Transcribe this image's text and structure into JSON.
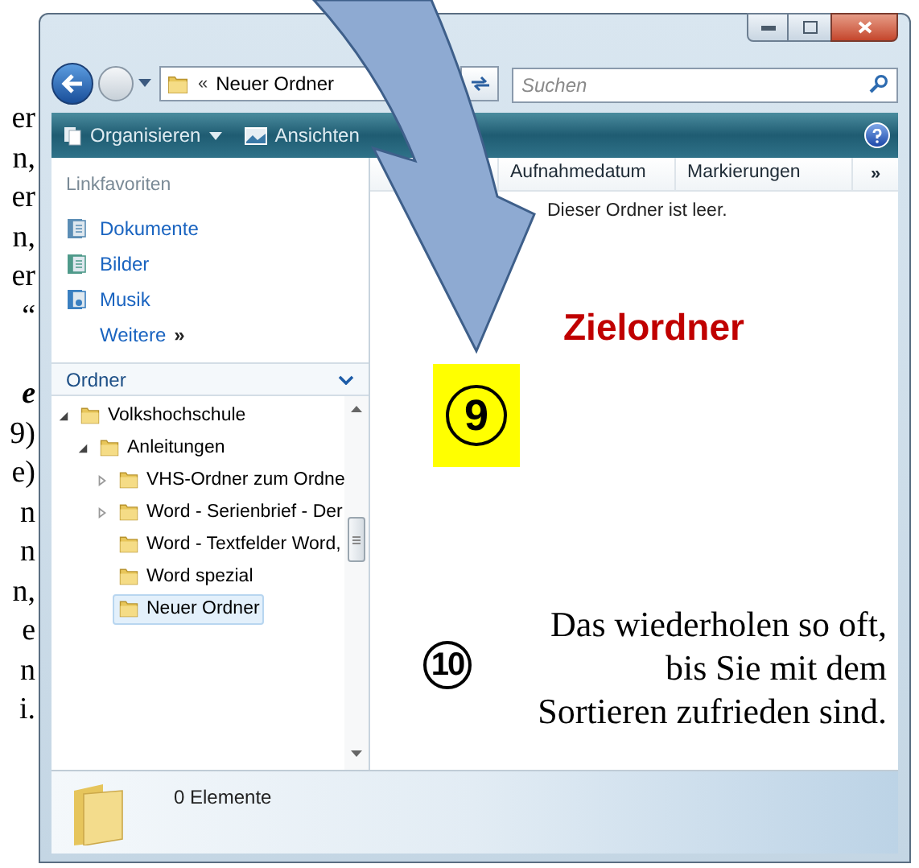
{
  "margin_text": [
    "er",
    "n,",
    "er",
    "n,",
    "er",
    "“",
    "e",
    "9)",
    "e)",
    "n",
    "n",
    "n,",
    "e",
    "n",
    "i."
  ],
  "window": {
    "address": {
      "prefix": "«",
      "path": "Neuer Ordner"
    },
    "search": {
      "placeholder": "Suchen"
    }
  },
  "toolbar": [
    {
      "label": "Organisieren",
      "has_menu": true,
      "kind": "organize"
    },
    {
      "label": "Ansichten",
      "has_menu": false,
      "kind": "views"
    }
  ],
  "favorites": {
    "title": "Linkfavoriten",
    "items": [
      {
        "label": "Dokumente",
        "kind": "documents"
      },
      {
        "label": "Bilder",
        "kind": "pictures"
      },
      {
        "label": "Musik",
        "kind": "music"
      }
    ],
    "more": "Weitere",
    "more_glyph": "»"
  },
  "folders": {
    "title": "Ordner",
    "tree": [
      {
        "label": "Volkshochschule",
        "expanded": true,
        "has_children": true,
        "selected": false,
        "children": [
          {
            "label": "Anleitungen",
            "expanded": true,
            "has_children": true,
            "selected": false,
            "children": [
              {
                "label": "VHS-Ordner zum Ordne",
                "expanded": false,
                "has_children": true,
                "selected": false
              },
              {
                "label": "Word - Serienbrief - Der",
                "expanded": false,
                "has_children": true,
                "selected": false
              },
              {
                "label": "Word - Textfelder Word,",
                "expanded": false,
                "has_children": false,
                "selected": false
              },
              {
                "label": "Word spezial",
                "expanded": false,
                "has_children": false,
                "selected": false
              },
              {
                "label": "Neuer Ordner",
                "expanded": false,
                "has_children": false,
                "selected": true
              }
            ]
          }
        ]
      }
    ]
  },
  "columns": [
    "Aufnahmedatum",
    "Markierungen"
  ],
  "more_columns": "»",
  "empty_message": "Dieser Ordner ist leer.",
  "status": "0 Elemente",
  "annotations": {
    "target_label": "Zielordner",
    "step_9": "9",
    "step_10": "10",
    "note_lines": [
      "Das wiederholen so oft,",
      "bis Sie mit dem",
      "Sortieren zufrieden sind."
    ]
  }
}
